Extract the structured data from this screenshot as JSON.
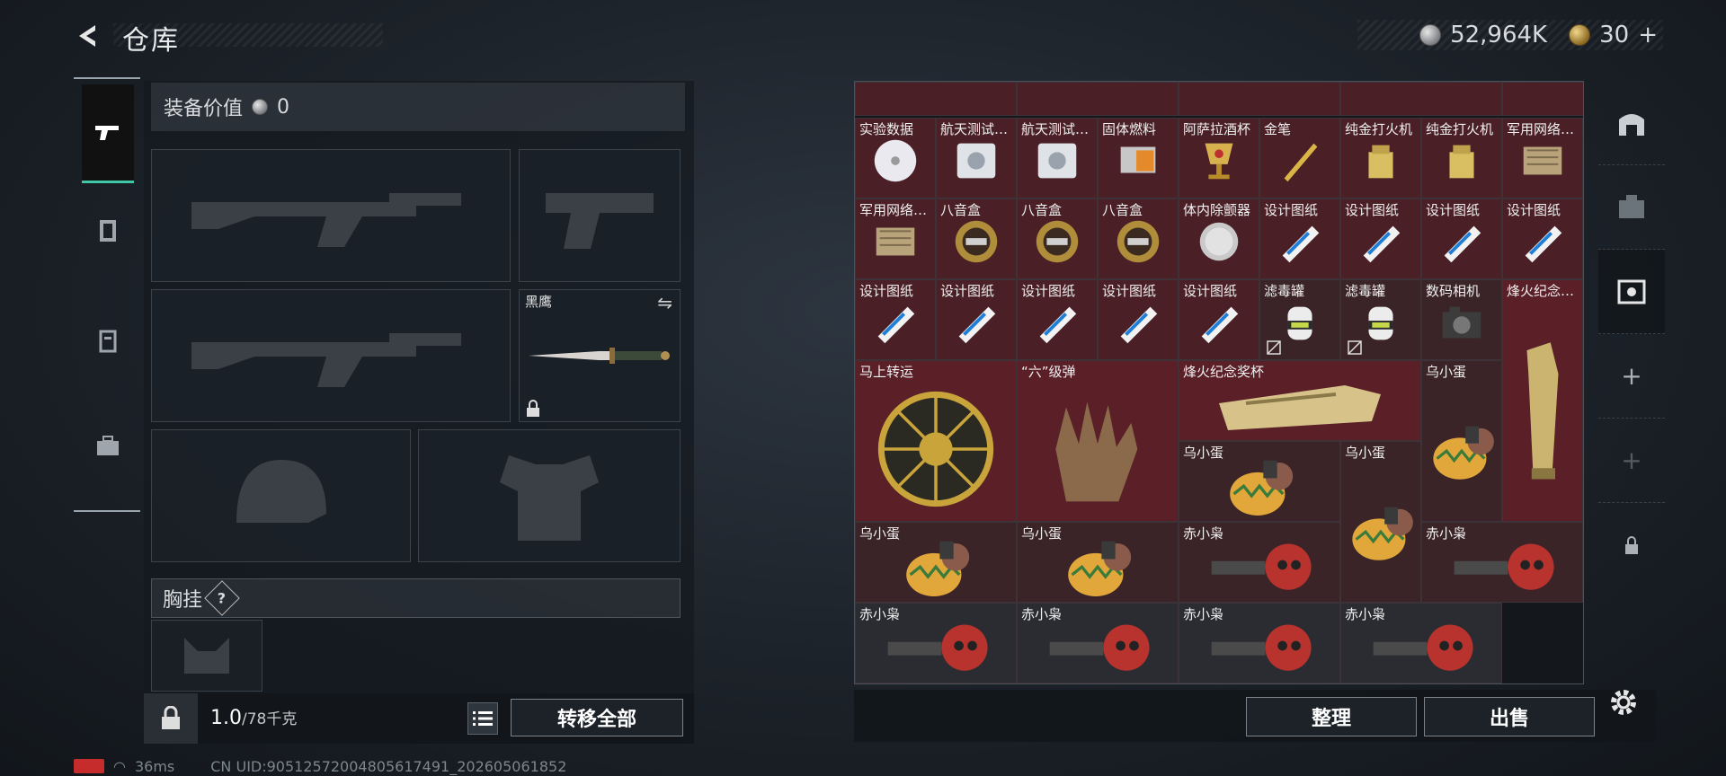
{
  "header": {
    "title": "仓库",
    "silver_amount": "52,964K",
    "gold_amount": "30",
    "gold_plus": "+"
  },
  "loadout": {
    "equip_value_label": "装备价值",
    "equip_value": "0",
    "melee_name": "黑鹰",
    "melee_swap_icon": "swap-icon",
    "chest_rig_label": "胸挂",
    "chest_rig_help": "?",
    "weight_current": "1.0",
    "weight_max": "/78千克",
    "transfer_all_label": "转移全部"
  },
  "storage": {
    "rows": [
      {
        "items": [
          {
            "label": "实验数据",
            "icon": "disc-icon",
            "cls": "red"
          },
          {
            "label": "航天测试…",
            "icon": "drive-icon",
            "cls": "red"
          },
          {
            "label": "航天测试…",
            "icon": "drive-icon",
            "cls": "red"
          },
          {
            "label": "固体燃料",
            "icon": "fuel-icon",
            "cls": "red"
          },
          {
            "label": "阿萨拉酒杯",
            "icon": "goblet-icon",
            "cls": "red"
          },
          {
            "label": "金笔",
            "icon": "pen-icon",
            "cls": "red"
          },
          {
            "label": "纯金打火机",
            "icon": "lighter-icon",
            "cls": "red"
          },
          {
            "label": "纯金打火机",
            "icon": "lighter-icon",
            "cls": "red"
          },
          {
            "label": "军用网络…",
            "icon": "module-icon",
            "cls": "red"
          }
        ]
      },
      {
        "items": [
          {
            "label": "军用网络…",
            "icon": "module-icon",
            "cls": "red"
          },
          {
            "label": "八音盒",
            "icon": "musicbox-icon",
            "cls": "red"
          },
          {
            "label": "八音盒",
            "icon": "musicbox-icon",
            "cls": "red"
          },
          {
            "label": "八音盒",
            "icon": "musicbox-icon",
            "cls": "red"
          },
          {
            "label": "体内除颤器",
            "icon": "defib-icon",
            "cls": "red"
          },
          {
            "label": "设计图纸",
            "icon": "blueprint-icon",
            "cls": "red"
          },
          {
            "label": "设计图纸",
            "icon": "blueprint-icon",
            "cls": "red"
          },
          {
            "label": "设计图纸",
            "icon": "blueprint-icon",
            "cls": "red"
          },
          {
            "label": "设计图纸",
            "icon": "blueprint-icon",
            "cls": "red"
          }
        ]
      },
      {
        "items": [
          {
            "label": "设计图纸",
            "icon": "blueprint-icon",
            "cls": "red"
          },
          {
            "label": "设计图纸",
            "icon": "blueprint-icon",
            "cls": "red"
          },
          {
            "label": "设计图纸",
            "icon": "blueprint-icon",
            "cls": "red"
          },
          {
            "label": "设计图纸",
            "icon": "blueprint-icon",
            "cls": "red"
          },
          {
            "label": "设计图纸",
            "icon": "blueprint-icon",
            "cls": "red"
          },
          {
            "label": "滤毒罐",
            "icon": "canister-icon",
            "cls": "dark"
          },
          {
            "label": "滤毒罐",
            "icon": "canister-icon",
            "cls": "dark"
          },
          {
            "label": "数码相机",
            "icon": "camera-icon",
            "cls": "dark"
          }
        ]
      }
    ],
    "tall_trophy_label": "烽火纪念…",
    "large_items": [
      {
        "label": "马上转运",
        "icon": "wheel-icon"
      },
      {
        "label": "“六”级弹",
        "icon": "glove-icon"
      },
      {
        "label": "烽火纪念奖杯",
        "icon": "trophy-icon"
      }
    ],
    "small_birds": [
      {
        "label": "乌小蛋",
        "icon": "egg-bird-icon"
      },
      {
        "label": "乌小蛋",
        "icon": "egg-bird-icon"
      },
      {
        "label": "乌小蛋",
        "icon": "egg-bird-icon"
      },
      {
        "label": "乌小蛋",
        "icon": "egg-bird-icon"
      },
      {
        "label": "乌小蛋",
        "icon": "egg-bird-icon"
      },
      {
        "label": "赤小枭",
        "icon": "owl-icon"
      },
      {
        "label": "赤小枭",
        "icon": "owl-icon"
      },
      {
        "label": "赤小枭",
        "icon": "owl-icon"
      },
      {
        "label": "赤小枭",
        "icon": "owl-icon"
      },
      {
        "label": "赤小枭",
        "icon": "owl-icon"
      },
      {
        "label": "赤小枭",
        "icon": "owl-icon"
      }
    ],
    "sort_label": "整理",
    "sell_label": "出售"
  },
  "status_bar": {
    "ping": "36ms",
    "uid": "CN UID:9051257200480561749​1_202605061852"
  },
  "colors": {
    "accent_active": "#3fc7a7",
    "item_bg_red": "#4a2026",
    "item_bg_gold": "#5a1f27"
  }
}
